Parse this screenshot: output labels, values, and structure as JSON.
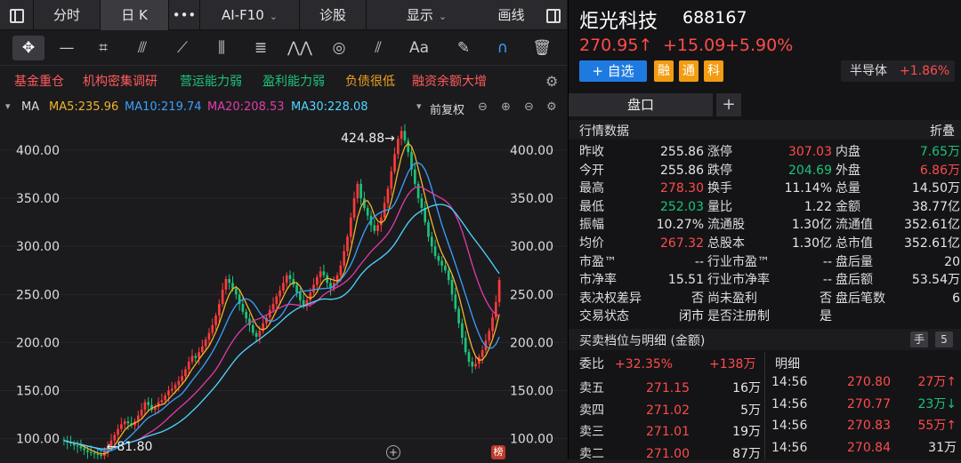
{
  "topbar": {
    "sidebar_toggle": "",
    "tab_fenshi": "分时",
    "tab_rik": "日 K",
    "more": "•••",
    "aif10": "AI-F10",
    "zhengu": "诊股",
    "xianshi": "显示",
    "huaxian": "画线"
  },
  "tags": [
    {
      "label": "基金重仓",
      "color": "#ff5a5a"
    },
    {
      "label": "机构密集调研",
      "color": "#ff5a5a"
    },
    {
      "label": "营运能力弱",
      "color": "#1cc37a"
    },
    {
      "label": "盈利能力弱",
      "color": "#1cc37a"
    },
    {
      "label": "负债很低",
      "color": "#f0a020"
    },
    {
      "label": "融资余额大增",
      "color": "#ff5a5a"
    }
  ],
  "ma_legend": {
    "label": "MA",
    "ma5": "MA5:235.96",
    "ma10": "MA10:219.74",
    "ma20": "MA20:208.53",
    "ma30": "MA30:228.08",
    "adjust": "前复权"
  },
  "chart_data": {
    "type": "candlestick",
    "y_ticks": [
      "400.00",
      "350.00",
      "300.00",
      "250.00",
      "200.00",
      "150.00",
      "100.00"
    ],
    "ylim": [
      95,
      425
    ],
    "annotations": {
      "high": "424.88→",
      "low": "←81.80"
    },
    "close": [
      98,
      96,
      95,
      93,
      92,
      90,
      88,
      86,
      85,
      84,
      83,
      82,
      88,
      92,
      98,
      104,
      110,
      115,
      118,
      116,
      114,
      118,
      124,
      130,
      138,
      135,
      130,
      133,
      138,
      140,
      145,
      150,
      152,
      156,
      160,
      165,
      172,
      180,
      186,
      184,
      190,
      196,
      203,
      210,
      218,
      228,
      240,
      255,
      266,
      262,
      256,
      250,
      240,
      232,
      225,
      218,
      210,
      206,
      212,
      220,
      226,
      234,
      240,
      248,
      254,
      262,
      270,
      266,
      260,
      252,
      244,
      238,
      244,
      252,
      260,
      268,
      274,
      270,
      262,
      256,
      262,
      270,
      280,
      295,
      310,
      330,
      350,
      365,
      350,
      340,
      332,
      322,
      316,
      322,
      330,
      345,
      360,
      378,
      396,
      412,
      420,
      410,
      398,
      380,
      365,
      350,
      340,
      325,
      310,
      300,
      290,
      285,
      280,
      275,
      265,
      250,
      235,
      220,
      205,
      190,
      180,
      175,
      178,
      185,
      192,
      202,
      212,
      226,
      242,
      265
    ],
    "ma_series": [
      {
        "name": "MA5",
        "color": "#f0b429",
        "window": 5
      },
      {
        "name": "MA10",
        "color": "#3aa0ff",
        "window": 10
      },
      {
        "name": "MA20",
        "color": "#e03ca8",
        "window": 20
      },
      {
        "name": "MA30",
        "color": "#4fd6ff",
        "window": 30
      }
    ]
  },
  "stock": {
    "name": "炬光科技",
    "code": "688167",
    "price": "270.95↑",
    "change": "+15.09",
    "pct": "+5.90%",
    "add_watch": "+ 自选",
    "badge1": "融",
    "badge2": "通",
    "badge3": "科",
    "sector_name": "半导体",
    "sector_pct": "+1.86%",
    "tab_pankou": "盘口",
    "tab_add": "+",
    "section_title": "行情数据",
    "collapse": "折叠"
  },
  "quote_rows": [
    {
      "l1": "昨收",
      "v1": "255.86",
      "c1": "white",
      "l2": "涨停",
      "v2": "307.03",
      "c2": "red",
      "l3": "内盘",
      "v3": "7.65万",
      "c3": "green"
    },
    {
      "l1": "今开",
      "v1": "255.86",
      "c1": "white",
      "l2": "跌停",
      "v2": "204.69",
      "c2": "green",
      "l3": "外盘",
      "v3": "6.86万",
      "c3": "red"
    },
    {
      "l1": "最高",
      "v1": "278.30",
      "c1": "red",
      "l2": "换手",
      "v2": "11.14%",
      "c2": "white",
      "l3": "总量",
      "v3": "14.50万",
      "c3": "white"
    },
    {
      "l1": "最低",
      "v1": "252.03",
      "c1": "green",
      "l2": "量比",
      "v2": "1.22",
      "c2": "white",
      "l3": "金额",
      "v3": "38.77亿",
      "c3": "white"
    },
    {
      "l1": "振幅",
      "v1": "10.27%",
      "c1": "white",
      "l2": "流通股",
      "v2": "1.30亿",
      "c2": "white",
      "l3": "流通值",
      "v3": "352.61亿",
      "c3": "white"
    },
    {
      "l1": "均价",
      "v1": "267.32",
      "c1": "red",
      "l2": "总股本",
      "v2": "1.30亿",
      "c2": "white",
      "l3": "总市值",
      "v3": "352.61亿",
      "c3": "white"
    },
    {
      "l1": "市盈™",
      "v1": "--",
      "c1": "white",
      "l2": "行业市盈™",
      "v2": "--",
      "c2": "white",
      "l3": "盘后量",
      "v3": "20",
      "c3": "white"
    },
    {
      "l1": "市净率",
      "v1": "15.51",
      "c1": "white",
      "l2": "行业市净率",
      "v2": "--",
      "c2": "white",
      "l3": "盘后额",
      "v3": "53.54万",
      "c3": "white"
    },
    {
      "l1": "表决权差异",
      "v1": "否",
      "c1": "white",
      "l2": "尚未盈利",
      "v2": "否",
      "c2": "white",
      "l3": "盘后笔数",
      "v3": "6",
      "c3": "white"
    },
    {
      "l1": "交易状态",
      "v1": "闭市",
      "c1": "white",
      "l2": "是否注册制",
      "v2": "是",
      "c2": "white",
      "l3": "",
      "v3": "",
      "c3": "white"
    }
  ],
  "orderbook": {
    "title": "买卖档位与明细 (金额)",
    "hand_btn": "手",
    "amount_btn": "5",
    "weibi_label": "委比",
    "weibi_pct": "+32.35%",
    "weibi_amt": "+138万",
    "detail_label": "明细",
    "levels": [
      {
        "name": "卖五",
        "price": "271.15",
        "vol": "16万"
      },
      {
        "name": "卖四",
        "price": "271.02",
        "vol": "5万"
      },
      {
        "name": "卖三",
        "price": "271.01",
        "vol": "19万"
      },
      {
        "name": "卖二",
        "price": "271.00",
        "vol": "87万"
      }
    ],
    "ticks": [
      {
        "time": "14:56",
        "price": "270.80",
        "vol": "27万↑",
        "pc": "red",
        "vc": "red"
      },
      {
        "time": "14:56",
        "price": "270.77",
        "vol": "23万↓",
        "pc": "red",
        "vc": "green"
      },
      {
        "time": "14:56",
        "price": "270.83",
        "vol": "55万↑",
        "pc": "red",
        "vc": "red"
      },
      {
        "time": "14:56",
        "price": "270.84",
        "vol": "31万",
        "pc": "red",
        "vc": "white"
      }
    ]
  }
}
